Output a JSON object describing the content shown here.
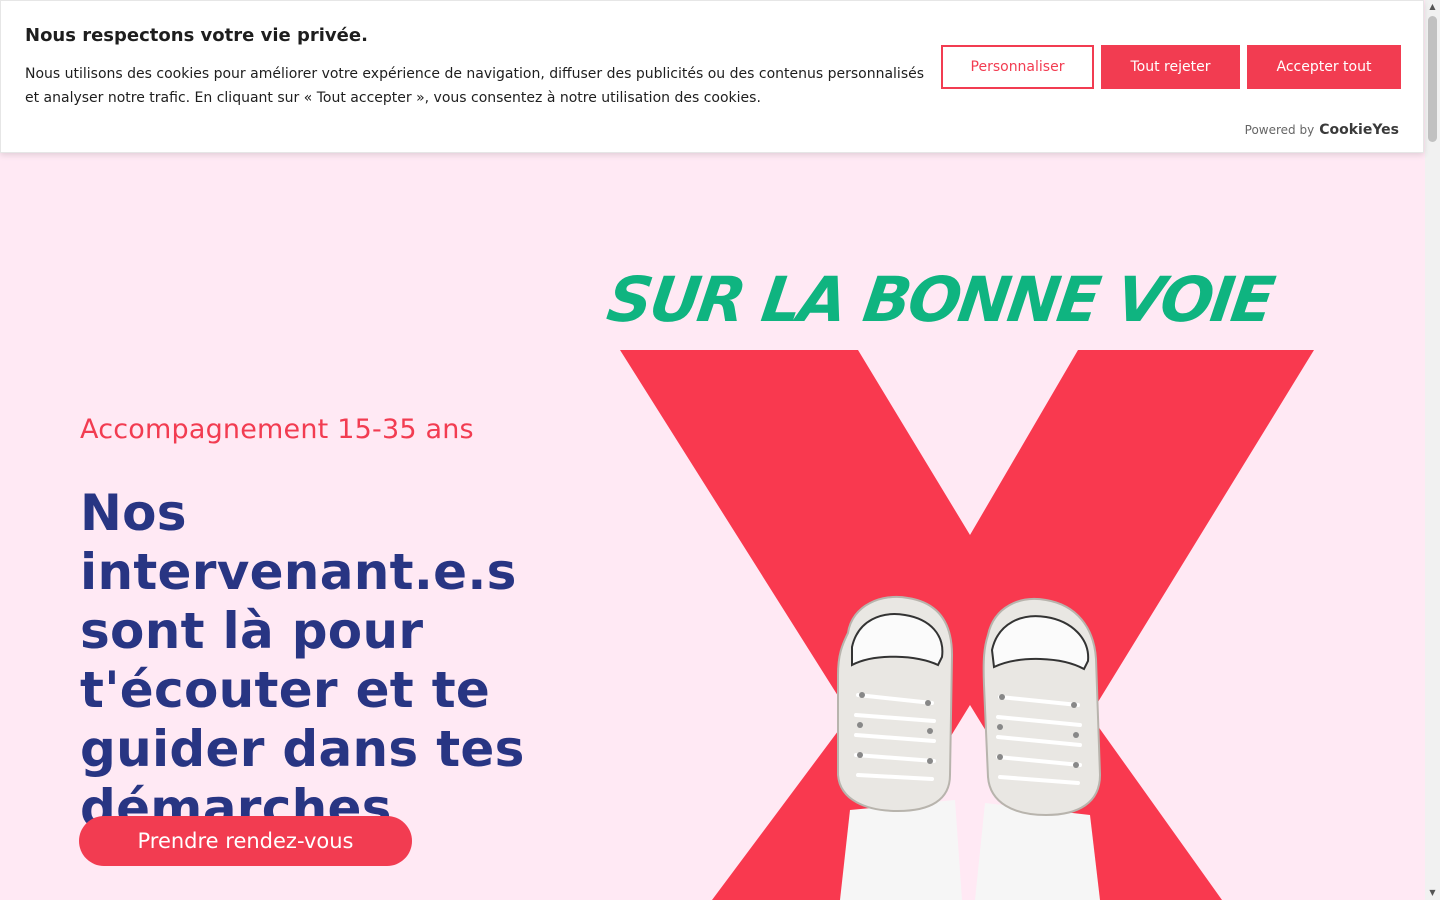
{
  "cookie_banner": {
    "title": "Nous respectons votre vie privée.",
    "text": "Nous utilisons des cookies pour améliorer votre expérience de navigation, diffuser des publicités ou des contenus personnalisés et analyser notre trafic. En cliquant sur « Tout accepter », vous consentez à notre utilisation des cookies.",
    "buttons": {
      "customize": "Personnaliser",
      "reject": "Tout rejeter",
      "accept": "Accepter tout"
    },
    "powered_by": "Powered by",
    "powered_brand": "CookieYes"
  },
  "hero": {
    "kicker": "Accompagnement 15-35 ans",
    "headline": "Nos intervenant.e.s sont là pour t'écouter et te guider dans tes démarches",
    "cta": "Prendre rendez-vous"
  },
  "artwork": {
    "title": "SUR LA BONNE VOIE"
  },
  "colors": {
    "background": "#ffe9f4",
    "accent_red": "#f23c51",
    "navy": "#283583",
    "green": "#0fb480"
  }
}
